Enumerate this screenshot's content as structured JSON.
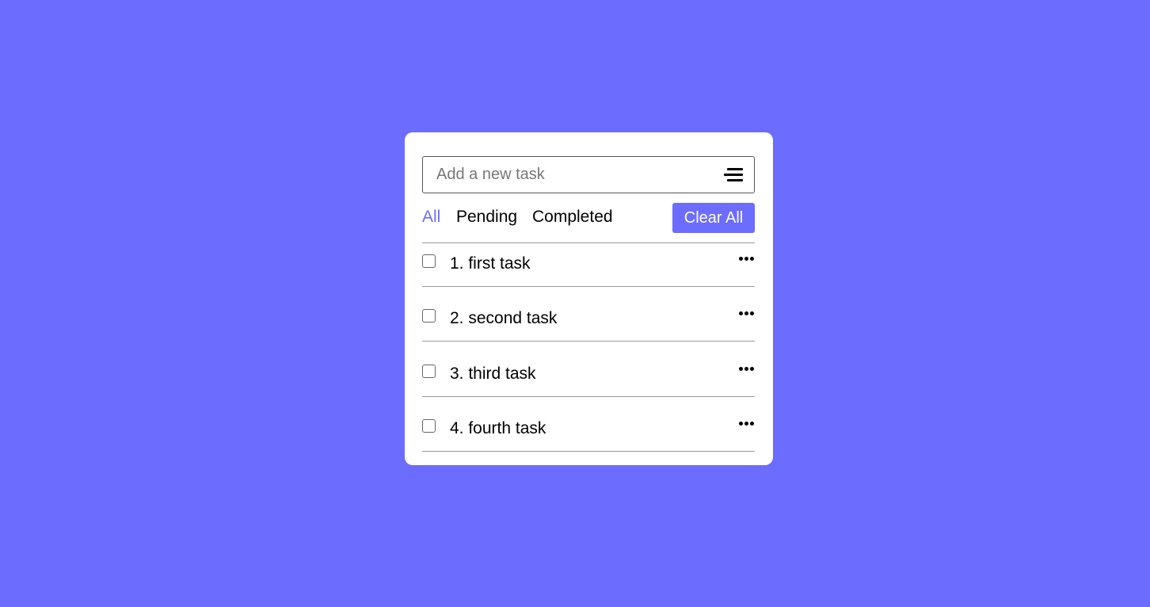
{
  "input": {
    "placeholder": "Add a new task",
    "value": ""
  },
  "filters": {
    "all": "All",
    "pending": "Pending",
    "completed": "Completed",
    "active": "All"
  },
  "clear_all_label": "Clear All",
  "tasks": [
    {
      "label": "1. first task",
      "checked": false
    },
    {
      "label": "2. second task",
      "checked": false
    },
    {
      "label": "3. third task",
      "checked": false
    },
    {
      "label": "4. fourth task",
      "checked": false
    }
  ],
  "icons": {
    "menu": "menu-icon",
    "more": "more-options-icon"
  },
  "colors": {
    "background": "#6c6cff",
    "accent": "#6c6cff",
    "card": "#ffffff"
  }
}
